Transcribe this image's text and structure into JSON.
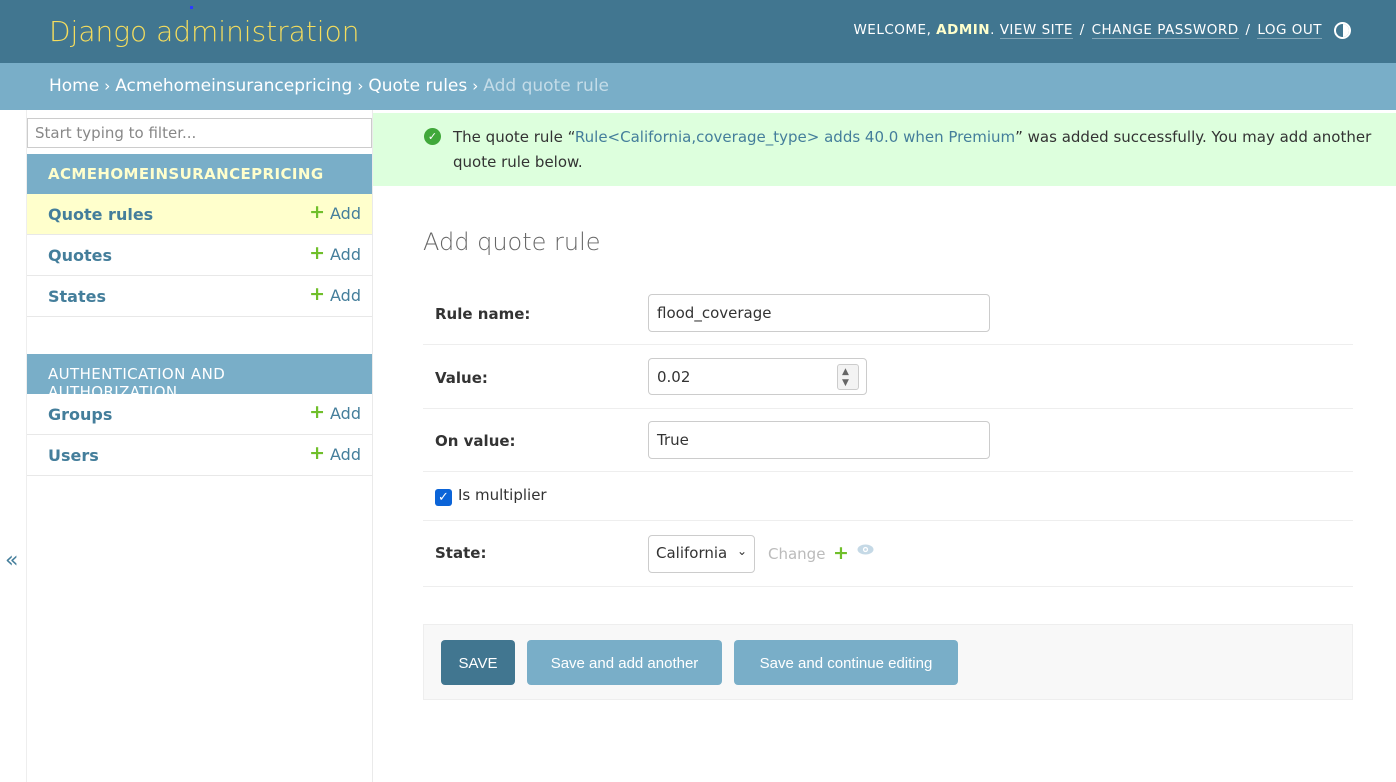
{
  "header": {
    "site_name": "Django administration",
    "welcome": "Welcome,",
    "username": "admin",
    "view_site": "View site",
    "change_password": "Change password",
    "log_out": "Log out",
    "sep": "/"
  },
  "breadcrumbs": {
    "home": "Home",
    "app": "Acmehomeinsurancepricing",
    "model": "Quote rules",
    "current": "Add quote rule",
    "sep": "›"
  },
  "sidebar": {
    "toggle_label": "«",
    "filter_placeholder": "Start typing to filter...",
    "apps": [
      {
        "caption": "Acmehomeinsurancepricing",
        "models": [
          {
            "name": "Quote rules",
            "add": "Add"
          },
          {
            "name": "Quotes",
            "add": "Add"
          },
          {
            "name": "States",
            "add": "Add"
          }
        ]
      },
      {
        "caption": "Authentication and Authorization",
        "models": [
          {
            "name": "Groups",
            "add": "Add"
          },
          {
            "name": "Users",
            "add": "Add"
          }
        ]
      }
    ]
  },
  "message": {
    "prefix": "The quote rule “",
    "link": "Rule<California,coverage_type> adds 40.0 when Premium",
    "suffix": "” was added successfully. You may add another quote rule below."
  },
  "form": {
    "title": "Add quote rule",
    "rule_name_label": "Rule name:",
    "rule_name_value": "flood_coverage",
    "value_label": "Value:",
    "value_value": "0.02",
    "on_value_label": "On value:",
    "on_value_value": "True",
    "is_multiplier_label": "Is multiplier",
    "is_multiplier_checked": true,
    "state_label": "State:",
    "state_selected": "California",
    "state_change": "Change"
  },
  "actions": {
    "save": "Save",
    "save_add_another": "Save and add another",
    "save_continue": "Save and continue editing"
  },
  "colors": {
    "header_bg": "#417690",
    "breadcrumb_bg": "#79aec8",
    "brand_yellow": "#f5dd5d",
    "success_bg": "#ddffdd",
    "link": "#447e9b",
    "add_green": "#70bf2b"
  }
}
